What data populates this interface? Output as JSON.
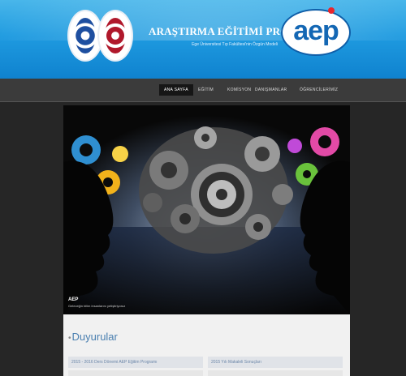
{
  "header": {
    "title": "ARAŞTIRMA EĞİTİMİ PROGRAMI",
    "subtitle": "Ege Üniversitesi Tıp Fakültesi'nin Özgün Modeli",
    "logo_text": "aep",
    "colors": {
      "banner": "#1f9be0",
      "logo_blue": "#1467b4",
      "logo_dot": "#e8262e"
    }
  },
  "nav": {
    "items": [
      {
        "label": "ANA SAYFA",
        "active": true
      },
      {
        "label": "EĞİTİM",
        "active": false
      },
      {
        "label": "KOMİSYON",
        "active": false
      },
      {
        "label": "DANIŞMANLAR",
        "active": false
      },
      {
        "label": "ÖĞRENCİLERİMİZ",
        "active": false
      }
    ]
  },
  "hero": {
    "caption_title": "AEP",
    "caption_text": "Geleceğin bilim insanlarını yetiştiriyoruz"
  },
  "announcements": {
    "title": "Duyurular",
    "items": [
      {
        "label": "2015 - 2016 Ders Dönemi AEP Eğitim Programı"
      },
      {
        "label": "2015 Yılı Makaleli Sonuçları"
      }
    ]
  }
}
